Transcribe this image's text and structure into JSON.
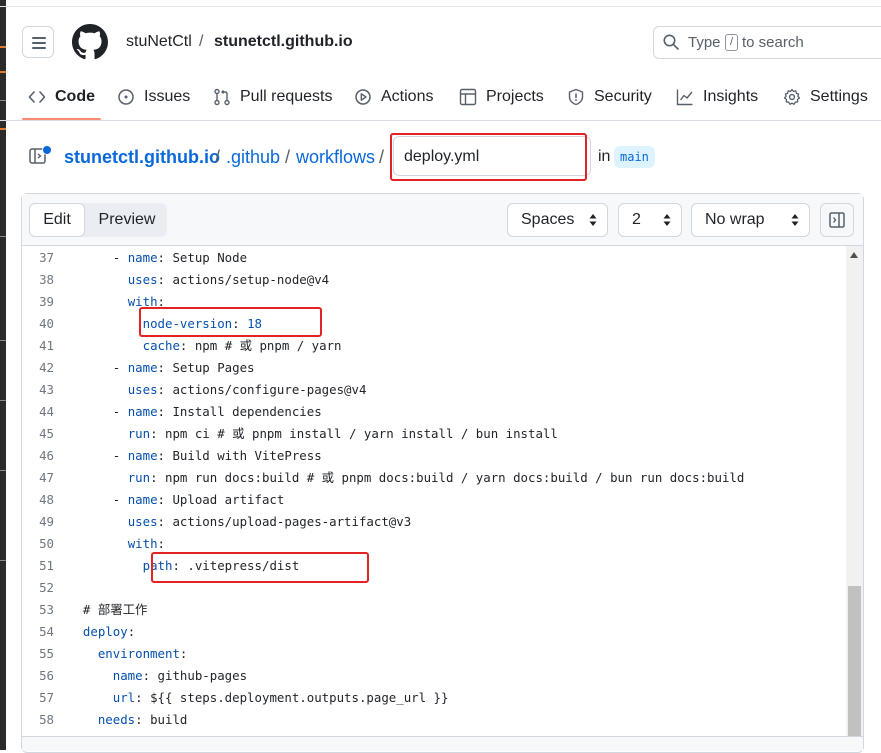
{
  "header": {
    "owner": "stuNetCtl",
    "separator": "/",
    "repo": "stunetctl.github.io",
    "search_prefix": "Type",
    "search_key": "/",
    "search_suffix": "to search"
  },
  "tabs": [
    {
      "label": "Code",
      "icon": "code-icon",
      "active": true
    },
    {
      "label": "Issues",
      "icon": "issue-icon"
    },
    {
      "label": "Pull requests",
      "icon": "pull-request-icon"
    },
    {
      "label": "Actions",
      "icon": "play-icon"
    },
    {
      "label": "Projects",
      "icon": "table-icon"
    },
    {
      "label": "Security",
      "icon": "shield-icon"
    },
    {
      "label": "Insights",
      "icon": "graph-icon"
    },
    {
      "label": "Settings",
      "icon": "gear-icon"
    }
  ],
  "breadcrumb": {
    "repo": "stunetctl.github.io",
    "sep": "/",
    "dir1": ".github",
    "dir2": "workflows",
    "filename": "deploy.yml",
    "in_label": "in",
    "branch": "main"
  },
  "toolbar": {
    "edit_label": "Edit",
    "preview_label": "Preview",
    "indent_mode": "Spaces",
    "indent_size": "2",
    "wrap_mode": "No wrap"
  },
  "code_lines": [
    {
      "n": "37",
      "indent": "      ",
      "dash": "- ",
      "key": "name",
      "val": " Setup Node"
    },
    {
      "n": "38",
      "indent": "        ",
      "dash": "",
      "key": "uses",
      "val": " actions/setup-node@v4"
    },
    {
      "n": "39",
      "indent": "        ",
      "dash": "",
      "key": "with",
      "val": ""
    },
    {
      "n": "40",
      "indent": "          ",
      "dash": "",
      "key": "node-version",
      "val": " 18",
      "valkey": true
    },
    {
      "n": "41",
      "indent": "          ",
      "dash": "",
      "key": "cache",
      "val": " npm # 或 pnpm / yarn"
    },
    {
      "n": "42",
      "indent": "      ",
      "dash": "- ",
      "key": "name",
      "val": " Setup Pages"
    },
    {
      "n": "43",
      "indent": "        ",
      "dash": "",
      "key": "uses",
      "val": " actions/configure-pages@v4"
    },
    {
      "n": "44",
      "indent": "      ",
      "dash": "- ",
      "key": "name",
      "val": " Install dependencies"
    },
    {
      "n": "45",
      "indent": "        ",
      "dash": "",
      "key": "run",
      "val": " npm ci # 或 pnpm install / yarn install / bun install"
    },
    {
      "n": "46",
      "indent": "      ",
      "dash": "- ",
      "key": "name",
      "val": " Build with VitePress"
    },
    {
      "n": "47",
      "indent": "        ",
      "dash": "",
      "key": "run",
      "val": " npm run docs:build # 或 pnpm docs:build / yarn docs:build / bun run docs:build"
    },
    {
      "n": "48",
      "indent": "      ",
      "dash": "- ",
      "key": "name",
      "val": " Upload artifact"
    },
    {
      "n": "49",
      "indent": "        ",
      "dash": "",
      "key": "uses",
      "val": " actions/upload-pages-artifact@v3"
    },
    {
      "n": "50",
      "indent": "        ",
      "dash": "",
      "key": "with",
      "val": ""
    },
    {
      "n": "51",
      "indent": "          ",
      "dash": "",
      "key": "path",
      "val": " .vitepress/dist"
    },
    {
      "n": "52",
      "indent": "",
      "dash": "",
      "key": "",
      "val": ""
    },
    {
      "n": "53",
      "indent": "  ",
      "dash": "",
      "key": "",
      "val": "# 部署工作",
      "raw": true
    },
    {
      "n": "54",
      "indent": "  ",
      "dash": "",
      "key": "deploy",
      "val": ""
    },
    {
      "n": "55",
      "indent": "    ",
      "dash": "",
      "key": "environment",
      "val": ""
    },
    {
      "n": "56",
      "indent": "      ",
      "dash": "",
      "key": "name",
      "val": " github-pages"
    },
    {
      "n": "57",
      "indent": "      ",
      "dash": "",
      "key": "url",
      "val": " ${{ steps.deployment.outputs.page_url }}"
    },
    {
      "n": "58",
      "indent": "    ",
      "dash": "",
      "key": "needs",
      "val": " build"
    }
  ],
  "colors": {
    "key": "#0550ae",
    "link": "#0969da",
    "active_tab_underline": "#fd8c73",
    "annotation_box": "#e32323"
  }
}
